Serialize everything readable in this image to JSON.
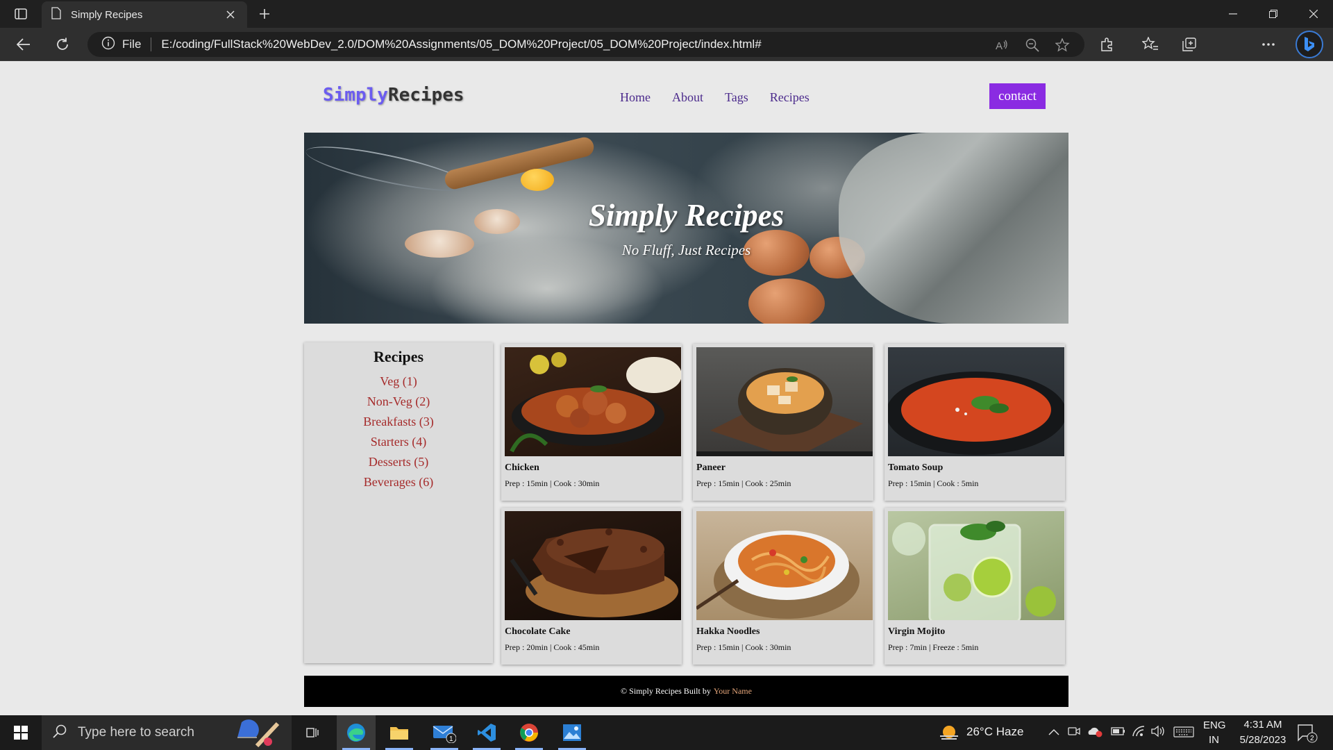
{
  "browser": {
    "tab_title": "Simply Recipes",
    "site_info_label": "File",
    "url": "E:/coding/FullStack%20WebDev_2.0/DOM%20Assignments/05_DOM%20Project/05_DOM%20Project/index.html#"
  },
  "site": {
    "logo_accent": "Simply",
    "logo_rest": "Recipes",
    "nav": [
      "Home",
      "About",
      "Tags",
      "Recipes"
    ],
    "contact_label": "contact"
  },
  "hero": {
    "title": "Simply Recipes",
    "subtitle": "No Fluff, Just Recipes"
  },
  "sidebar": {
    "heading": "Recipes",
    "items": [
      "Veg (1)",
      "Non-Veg (2)",
      "Breakfasts (3)",
      "Starters (4)",
      "Desserts (5)",
      "Beverages (6)"
    ]
  },
  "recipes": [
    {
      "name": "Chicken",
      "meta": "Prep : 15min | Cook : 30min",
      "image": "chicken-curry-photo"
    },
    {
      "name": "Paneer",
      "meta": "Prep : 15min | Cook : 25min",
      "image": "paneer-curry-photo"
    },
    {
      "name": "Tomato Soup",
      "meta": "Prep : 15min | Cook : 5min",
      "image": "tomato-soup-photo"
    },
    {
      "name": "Chocolate Cake",
      "meta": "Prep : 20min | Cook : 45min",
      "image": "chocolate-cake-photo"
    },
    {
      "name": "Hakka Noodles",
      "meta": "Prep : 15min | Cook : 30min",
      "image": "hakka-noodles-photo"
    },
    {
      "name": "Virgin Mojito",
      "meta": "Prep : 7min | Freeze : 5min",
      "image": "virgin-mojito-photo"
    }
  ],
  "footer": {
    "text": "© Simply Recipes Built by",
    "author": "Your Name"
  },
  "taskbar": {
    "search_placeholder": "Type here to search",
    "weather": "26°C  Haze",
    "lang_top": "ENG",
    "lang_bottom": "IN",
    "time": "4:31 AM",
    "date": "5/28/2023",
    "mail_badge": "1",
    "notification_badge": "2"
  },
  "colors": {
    "accent_purple": "#8a2be2",
    "logo_accent": "#6b5cf0",
    "sidebar_link": "#a52a2a",
    "footer_author": "#e8a87c"
  }
}
